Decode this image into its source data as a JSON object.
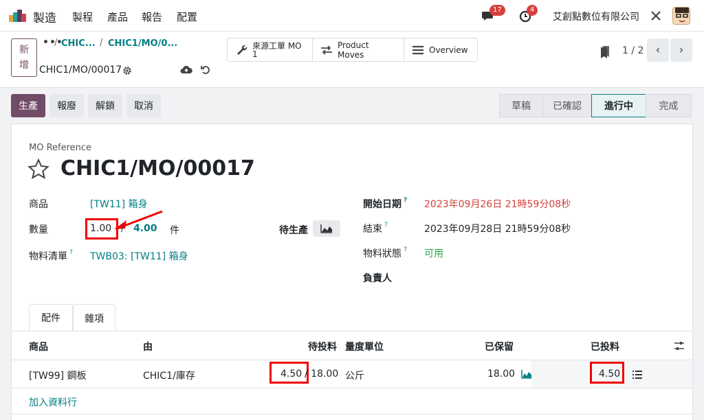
{
  "nav": {
    "app_name": "製造",
    "menus": [
      "製程",
      "產品",
      "報告",
      "配置"
    ],
    "messages_count": "17",
    "activities_count": "4",
    "company": "艾創點數位有限公司"
  },
  "control_panel": {
    "new_button": "新增",
    "breadcrumb_dots": "•••",
    "breadcrumbs": [
      "CHIC...",
      "CHIC1/MO/0..."
    ],
    "record_name": "CHIC1/MO/00017",
    "smart_buttons": {
      "source_mo": "來源工單 MO 1",
      "product_moves": "Product Moves",
      "overview": "Overview"
    },
    "pager": "1 / 2"
  },
  "actions": {
    "produce": "生產",
    "scrap": "報廢",
    "unlock": "解鎖",
    "cancel": "取消"
  },
  "statusbar": {
    "steps": [
      "草稿",
      "已確認",
      "進行中",
      "完成"
    ],
    "active": "進行中"
  },
  "form": {
    "mo_ref_label": "MO Reference",
    "title": "CHIC1/MO/00017",
    "product_label": "商品",
    "product_value": "[TW11] 箱身",
    "qty_label": "數量",
    "qty_producing": "1.00",
    "qty_sep": "/",
    "qty_total": "4.00",
    "qty_uom": "件",
    "to_produce_label": "待生產",
    "bom_label": "物料清單",
    "bom_help": "?",
    "bom_value": "TWB03: [TW11] 箱身",
    "start_label": "開始日期",
    "start_help": "?",
    "start_value": "2023年09月26日 21時59分08秒",
    "end_label": "結束",
    "end_help": "?",
    "end_value": "2023年09月28日 21時59分08秒",
    "material_label": "物料狀態",
    "material_help": "?",
    "material_value": "可用",
    "responsible_label": "負責人"
  },
  "tabs": [
    "配件",
    "雜項"
  ],
  "components": {
    "headers": [
      "商品",
      "由",
      "待投料",
      "量度單位",
      "已保留",
      "已投料"
    ],
    "rows": [
      {
        "product": "[TW99] 鋼板",
        "from": "CHIC1/庫存",
        "to_consume": "4.50",
        "to_consume_total": "/ 18.00",
        "uom": "公斤",
        "reserved": "18.00",
        "consumed": "4.50"
      }
    ],
    "add_line": "加入資料行"
  },
  "colors": {
    "brand": "#714b67",
    "link": "#017e84",
    "alert": "#d23f3a",
    "ok": "#28a745",
    "highlight_box": "#ee0000"
  }
}
